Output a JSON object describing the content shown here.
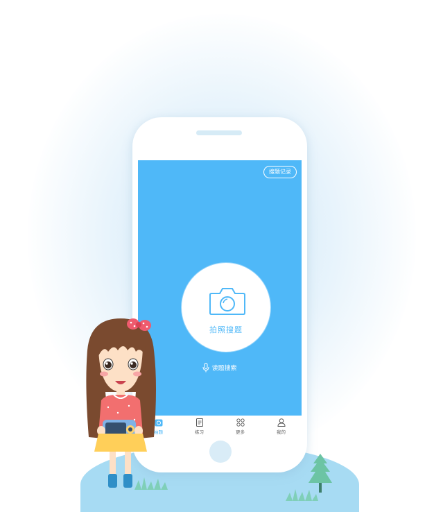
{
  "screen": {
    "history_button": "搜题记录",
    "camera_label": "拍照搜题",
    "voice_label": "读题搜索"
  },
  "tabs": [
    {
      "label": "拍题",
      "icon": "camera-icon",
      "active": true
    },
    {
      "label": "练习",
      "icon": "document-icon",
      "active": false
    },
    {
      "label": "更多",
      "icon": "grid-icon",
      "active": false
    },
    {
      "label": "我的",
      "icon": "user-icon",
      "active": false
    }
  ],
  "colors": {
    "accent": "#4fb8f8",
    "ground": "#a7dbf3"
  }
}
